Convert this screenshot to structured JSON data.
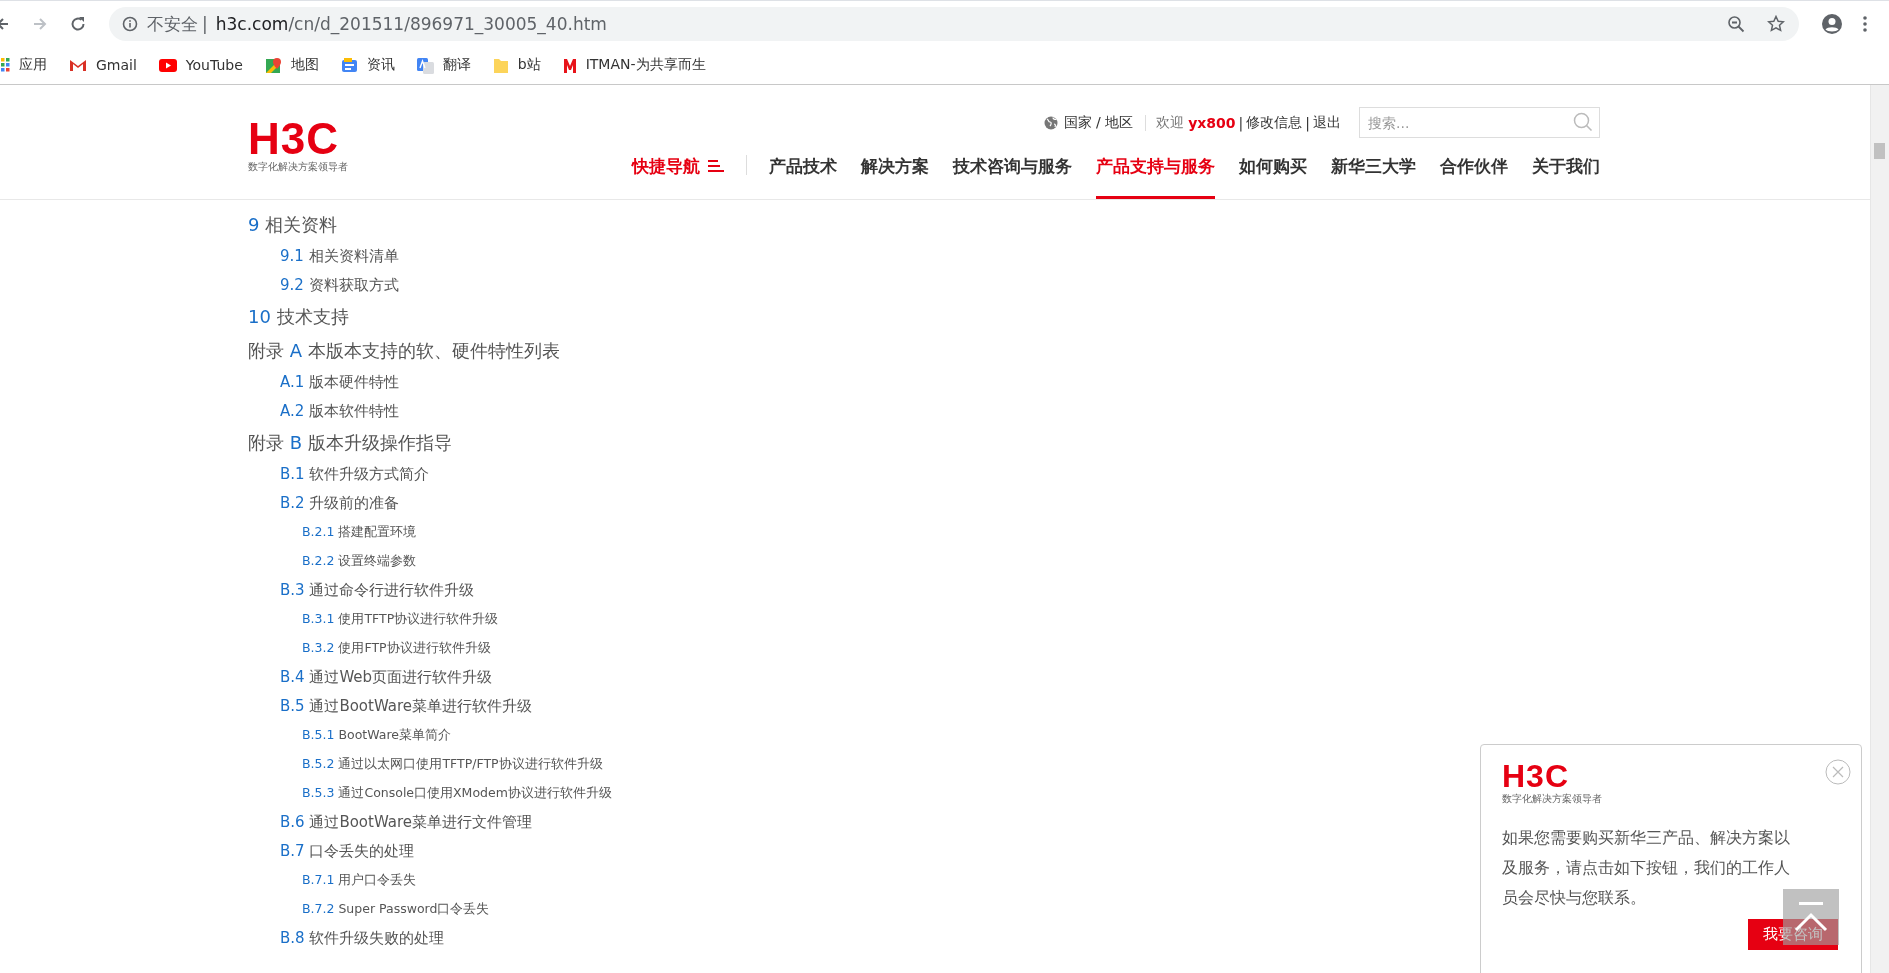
{
  "address_bar": {
    "security_label": "不安全",
    "separator": "|",
    "host": "h3c.com",
    "path": "/cn/d_201511/896971_30005_40.htm"
  },
  "bookmarks": [
    {
      "kind": "apps",
      "label": "应用"
    },
    {
      "kind": "gmail",
      "label": "Gmail"
    },
    {
      "kind": "youtube",
      "label": "YouTube"
    },
    {
      "kind": "maps",
      "label": "地图"
    },
    {
      "kind": "news",
      "label": "资讯"
    },
    {
      "kind": "translate",
      "label": "翻译"
    },
    {
      "kind": "folder",
      "label": "b站"
    },
    {
      "kind": "itman",
      "label": "ITMAN-为共享而生"
    }
  ],
  "header": {
    "logo": {
      "mark": "H3C",
      "tagline": "数字化解决方案领导者"
    },
    "region_link": "国家 / 地区",
    "welcome": "欢迎",
    "username": "yx800",
    "edit_profile": "修改信息",
    "logout": "退出",
    "separator": "|",
    "search": {
      "placeholder": "搜索..."
    },
    "quick_nav": "快捷导航",
    "nav": [
      {
        "label": "产品技术",
        "selected": false
      },
      {
        "label": "解决方案",
        "selected": false
      },
      {
        "label": "技术咨询与服务",
        "selected": false
      },
      {
        "label": "产品支持与服务",
        "selected": true
      },
      {
        "label": "如何购买",
        "selected": false
      },
      {
        "label": "新华三大学",
        "selected": false
      },
      {
        "label": "合作伙伴",
        "selected": false
      },
      {
        "label": "关于我们",
        "selected": false
      }
    ]
  },
  "toc": [
    {
      "number": "9",
      "title": "相关资料",
      "children": [
        {
          "number": "9.1",
          "title": "相关资料清单"
        },
        {
          "number": "9.2",
          "title": "资料获取方式"
        }
      ]
    },
    {
      "number": "10",
      "title": "技术支持"
    },
    {
      "prefix": "附录",
      "number": "A",
      "title": "本版本支持的软、硬件特性列表",
      "children": [
        {
          "number": "A.1",
          "title": "版本硬件特性"
        },
        {
          "number": "A.2",
          "title": "版本软件特性"
        }
      ]
    },
    {
      "prefix": "附录",
      "number": "B",
      "title": "版本升级操作指导",
      "children": [
        {
          "number": "B.1",
          "title": "软件升级方式简介"
        },
        {
          "number": "B.2",
          "title": "升级前的准备",
          "children": [
            {
              "number": "B.2.1",
              "title": "搭建配置环境"
            },
            {
              "number": "B.2.2",
              "title": "设置终端参数"
            }
          ]
        },
        {
          "number": "B.3",
          "title": "通过命令行进行软件升级",
          "children": [
            {
              "number": "B.3.1",
              "title": "使用TFTP协议进行软件升级"
            },
            {
              "number": "B.3.2",
              "title": "使用FTP协议进行软件升级"
            }
          ]
        },
        {
          "number": "B.4",
          "title": "通过Web页面进行软件升级"
        },
        {
          "number": "B.5",
          "title": "通过BootWare菜单进行软件升级",
          "children": [
            {
              "number": "B.5.1",
              "title": "BootWare菜单简介"
            },
            {
              "number": "B.5.2",
              "title": "通过以太网口使用TFTP/FTP协议进行软件升级"
            },
            {
              "number": "B.5.3",
              "title": "通过Console口使用XModem协议进行软件升级"
            }
          ]
        },
        {
          "number": "B.6",
          "title": "通过BootWare菜单进行文件管理"
        },
        {
          "number": "B.7",
          "title": "口令丢失的处理",
          "children": [
            {
              "number": "B.7.1",
              "title": "用户口令丢失"
            },
            {
              "number": "B.7.2",
              "title": "Super Password口令丢失"
            }
          ]
        },
        {
          "number": "B.8",
          "title": "软件升级失败的处理"
        }
      ]
    }
  ],
  "popup": {
    "logo": {
      "mark": "H3C",
      "tagline": "数字化解决方案领导者"
    },
    "message": "如果您需要购买新华三产品、解决方案以及服务，请点击如下按钮，我们的工作人员会尽快与您联系。",
    "button": "我要咨询"
  }
}
